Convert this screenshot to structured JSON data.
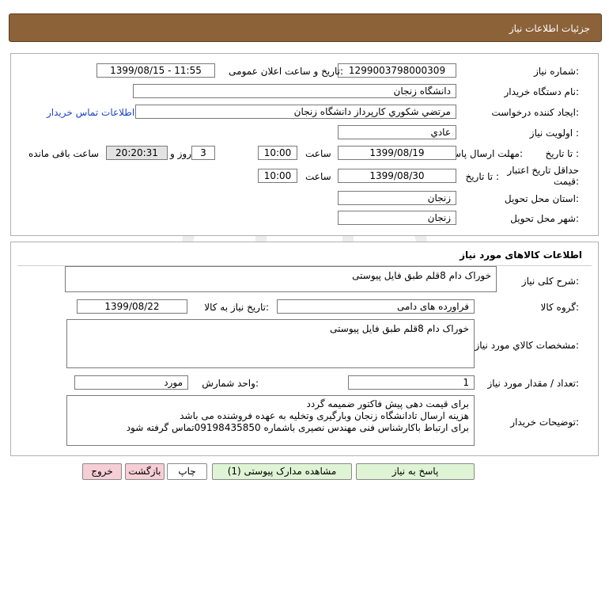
{
  "header": {
    "title": "جزئیات اطلاعات نیاز"
  },
  "info": {
    "need_number_label": "شماره نیاز:",
    "need_number": "1299003798000309",
    "announce_label": "تاریخ و ساعت اعلان عمومی:",
    "announce_value": "1399/08/15 - 11:55",
    "buyer_org_label": "نام دستگاه خریدار:",
    "buyer_org": "دانشگاه زنجان",
    "creator_label": "ایجاد کننده درخواست:",
    "creator": "مرتضي شکوري کارپرداز دانشگاه زنجان",
    "contact_link": "اطلاعات تماس خریدار",
    "priority_label": "اولویت نیاز :",
    "priority": "عادي",
    "deadline_label": "مهلت ارسال پاسخ:",
    "until_date_label": "تا تاریخ :",
    "deadline_date": "1399/08/19",
    "time_label": "ساعت",
    "deadline_time": "10:00",
    "days_value": "3",
    "days_label": "روز و",
    "remaining_time": "20:20:31",
    "remaining_label": "ساعت باقی مانده",
    "validity_label": "حداقل تاریخ اعتبار قیمت:",
    "validity_until_label": "تا تاریخ :",
    "validity_date": "1399/08/30",
    "validity_time_label": "ساعت",
    "validity_time": "10:00",
    "province_label": "استان محل تحویل:",
    "province": "زنجان",
    "city_label": "شهر محل تحویل:",
    "city": "زنجان"
  },
  "goods": {
    "section_title": "اطلاعات کالاهای مورد نیاز",
    "general_desc_label": "شرح کلی نیاز:",
    "general_desc": "خوراک دام 8قلم طبق فایل پیوستی",
    "group_label": "گروه کالا:",
    "group": "فراورده های دامی",
    "need_date_label": "تاریخ نیاز به کالا:",
    "need_date": "1399/08/22",
    "specs_label": "مشخصات کالاي مورد نیاز:",
    "specs": "خوراک دام 8قلم طبق فایل پیوستی",
    "qty_label": "تعداد / مقدار مورد نیاز:",
    "qty": "1",
    "unit_label": "واحد شمارش:",
    "unit": "مورد",
    "buyer_notes_label": "توضیحات خریدار:",
    "buyer_notes": "برای قیمت دهی پیش فاکتور ضمیمه گردد\nهزینه ارسال تادانشگاه زنجان وبارگیری وتخلیه به عهده فروشنده می باشد\nبرای ارتباط باکارشناس فنی مهندس نصیری باشماره 09198435850تماس گرفته شود"
  },
  "buttons": {
    "respond": "پاسخ به نیاز",
    "attachments": "مشاهده مدارک پیوستی (1)",
    "print": "چاپ",
    "back": "بازگشت",
    "exit": "خروج"
  },
  "colors": {
    "header_bg": "#8c6239",
    "link": "#1a44c8",
    "green_button": "#dff3d5",
    "red_button": "#f6cfd6"
  }
}
